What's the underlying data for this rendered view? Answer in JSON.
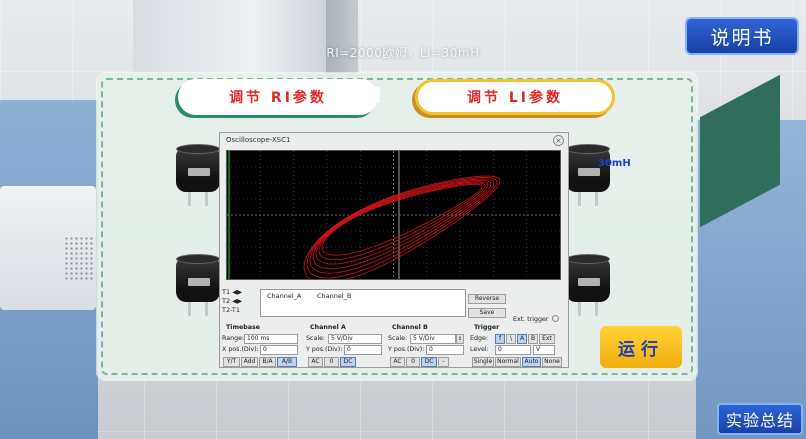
{
  "scene": {
    "title": "RI=2000欧姆，LI=30mH",
    "manual_button": "说明书",
    "summary_button": "实验总结"
  },
  "panel": {
    "tab_ri": "调节 RI参数",
    "tab_li": "调节 LI参数",
    "run_button": "运行",
    "inductor_value": "30mH"
  },
  "oscilloscope": {
    "title": "Oscilloscope-XSC1",
    "cursor_labels": [
      "T1",
      "T2",
      "T2-T1"
    ],
    "channel_columns": [
      "Channel_A",
      "Channel_B"
    ],
    "reverse": "Reverse",
    "save": "Save",
    "ext_trigger": "Ext. trigger",
    "timebase": {
      "title": "Timebase",
      "scale_label": "Range:",
      "scale_value": "100 ms",
      "xpos_label": "X pos.(Div):",
      "xpos_value": "0",
      "modes": [
        "Y/T",
        "Add",
        "B/A",
        "A/B"
      ],
      "active_mode": "A/B"
    },
    "channel_a": {
      "title": "Channel A",
      "scale_label": "Scale:",
      "scale_value": "5 V/Div",
      "ypos_label": "Y pos.(Div):",
      "ypos_value": "0",
      "coupling": [
        "AC",
        "0",
        "DC"
      ],
      "active": "DC"
    },
    "channel_b": {
      "title": "Channel B",
      "scale_label": "Scale:",
      "scale_value": "5 V/Div",
      "ypos_label": "Y pos.(Div):",
      "ypos_value": "0",
      "coupling": [
        "AC",
        "0",
        "DC",
        "-"
      ],
      "active": "DC"
    },
    "trigger": {
      "title": "Trigger",
      "edge_label": "Edge:",
      "edges": [
        "f",
        "\\",
        "A",
        "B",
        "Ext"
      ],
      "level_label": "Level:",
      "level_value": "0",
      "level_unit": "V",
      "modes": [
        "Single",
        "Normal",
        "Auto",
        "None"
      ],
      "active_mode": "Auto"
    },
    "trace_color": "#e0151b",
    "cursor_color": "#2fd02f"
  }
}
